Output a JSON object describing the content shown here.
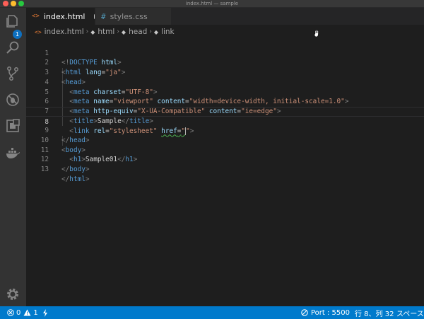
{
  "window": {
    "title": "index.html — sample"
  },
  "activity_bar": {
    "items": [
      "explorer-icon",
      "search-icon",
      "source-control-icon",
      "debug-icon",
      "extensions-icon",
      "docker-icon"
    ],
    "explorer_badge": "1",
    "settings_icon": "gear-icon"
  },
  "tabs": [
    {
      "label": "index.html",
      "icon": "<>",
      "active": true,
      "modified": true
    },
    {
      "label": "styles.css",
      "icon": "#",
      "active": false,
      "modified": false
    }
  ],
  "breadcrumb": [
    "index.html",
    "html",
    "head",
    "link"
  ],
  "editor": {
    "current_line": 8,
    "line_numbers": [
      "1",
      "2",
      "3",
      "4",
      "5",
      "6",
      "7",
      "8",
      "9",
      "10",
      "11",
      "12",
      "13"
    ]
  },
  "status": {
    "errors": "0",
    "warnings": "1",
    "port": "Port : 5500",
    "cursor_pos": "行 8、列 32",
    "indent": "スペース"
  },
  "colors": {
    "status_bar": "#007acc",
    "tag": "#569cd6",
    "attribute": "#9cdcfe",
    "string": "#ce9178"
  }
}
